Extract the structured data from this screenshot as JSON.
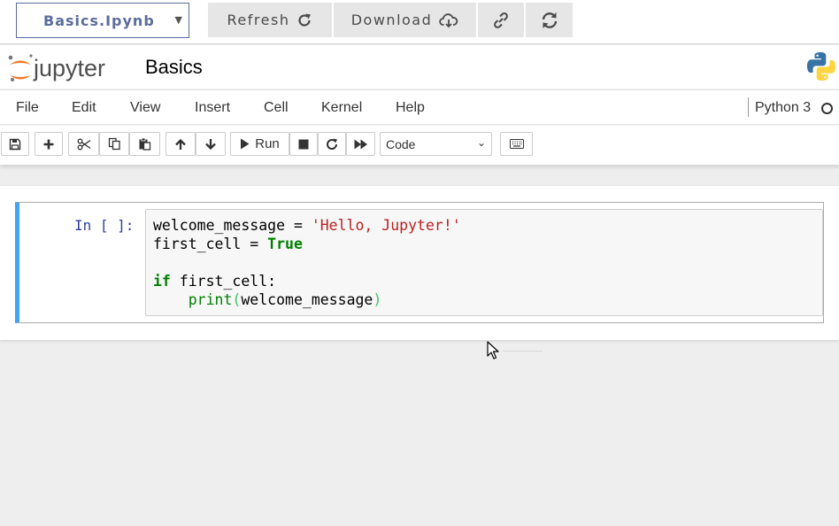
{
  "controls": {
    "file_select_value": "Basics.Ipynb",
    "refresh_label": "Refresh",
    "download_label": "Download"
  },
  "header": {
    "logo_text": "jupyter",
    "notebook_title": "Basics"
  },
  "menubar": {
    "items": [
      "File",
      "Edit",
      "View",
      "Insert",
      "Cell",
      "Kernel",
      "Help"
    ],
    "kernel_name": "Python 3"
  },
  "toolbar": {
    "run_label": "Run",
    "cell_type_value": "Code"
  },
  "cell": {
    "prompt": "In [ ]:",
    "code": {
      "line1_var": "welcome_message = ",
      "line1_str": "'Hello, Jupyter!'",
      "line2_var": "first_cell = ",
      "line2_kw": "True",
      "line4_kw": "if",
      "line4_rest": " first_cell:",
      "line5_indent": "    ",
      "line5_fn": "print",
      "line5_open": "(",
      "line5_arg": "welcome_message",
      "line5_close": ")"
    }
  },
  "colors": {
    "cell_accent": "#42a5f5",
    "prompt": "#303f9f",
    "string": "#ba2121",
    "keyword": "#008000",
    "jupyter_orange": "#f37726"
  }
}
